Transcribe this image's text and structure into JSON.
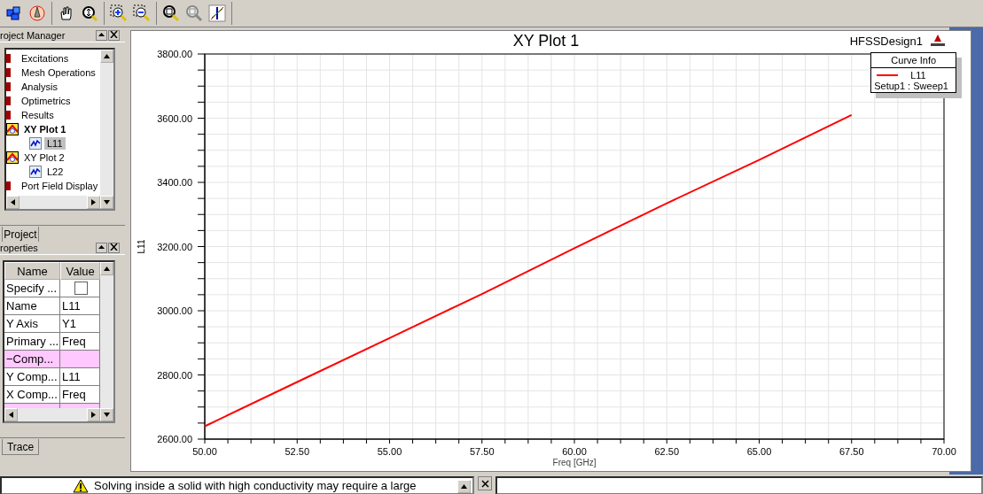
{
  "project_manager": {
    "title": "roject Manager",
    "tab": "Project",
    "tree": [
      {
        "label": "Excitations",
        "kind": "folder",
        "selected": false,
        "active": false
      },
      {
        "label": "Mesh Operations",
        "kind": "folder",
        "selected": false,
        "active": false
      },
      {
        "label": "Analysis",
        "kind": "folder",
        "selected": false,
        "active": false
      },
      {
        "label": "Optimetrics",
        "kind": "folder",
        "selected": false,
        "active": false
      },
      {
        "label": "Results",
        "kind": "folder",
        "selected": false,
        "active": false
      },
      {
        "label": "XY Plot 1",
        "kind": "plot",
        "selected": false,
        "active": true,
        "children": [
          {
            "label": "L11",
            "kind": "trace",
            "selected": true,
            "active": false
          }
        ]
      },
      {
        "label": "XY Plot 2",
        "kind": "plot",
        "selected": false,
        "active": false,
        "children": [
          {
            "label": "L22",
            "kind": "trace",
            "selected": false,
            "active": false
          }
        ]
      },
      {
        "label": "Port Field Display",
        "kind": "folder",
        "selected": false,
        "active": false
      }
    ]
  },
  "properties": {
    "title": "roperties",
    "tab": "Trace",
    "columns": [
      "Name",
      "Value"
    ],
    "rows": [
      {
        "kind": "checkbox",
        "name": "Specify ...",
        "checked": false
      },
      {
        "kind": "text",
        "name": "Name",
        "value": "L11"
      },
      {
        "kind": "text",
        "name": "Y Axis",
        "value": "Y1"
      },
      {
        "kind": "text",
        "name": "Primary ...",
        "value": "Freq"
      },
      {
        "kind": "section",
        "name": "−Comp..."
      },
      {
        "kind": "text",
        "name": "Y Comp...",
        "value": "L11"
      },
      {
        "kind": "text",
        "name": "X Comp...",
        "value": "Freq"
      },
      {
        "kind": "section"
      }
    ]
  },
  "plot": {
    "title": "XY Plot 1",
    "design": "HFSSDesign1",
    "legend": {
      "title": "Curve Info",
      "detail": "Setup1 : Sweep1"
    },
    "chart_data": {
      "type": "line",
      "xlabel": "Freq [GHz]",
      "ylabel": "L11",
      "grid": true,
      "x": [
        50,
        52.5,
        55,
        57.5,
        60,
        62.5,
        65,
        67.5
      ],
      "series": [
        {
          "name": "L11",
          "color": "#ff0000",
          "values": [
            2640,
            2778,
            2915,
            3052,
            3195,
            3335,
            3470,
            3610
          ]
        }
      ],
      "xlim": [
        50,
        70
      ],
      "ylim": [
        2600,
        3800
      ],
      "xticks": [
        {
          "value": 50,
          "label": "50.00"
        },
        {
          "value": 52.5,
          "label": "52.50"
        },
        {
          "value": 55,
          "label": "55.00"
        },
        {
          "value": 57.5,
          "label": "57.50"
        },
        {
          "value": 60,
          "label": "60.00"
        },
        {
          "value": 62.5,
          "label": "62.50"
        },
        {
          "value": 65,
          "label": "65.00"
        },
        {
          "value": 67.5,
          "label": "67.50"
        },
        {
          "value": 70,
          "label": "70.00"
        }
      ],
      "yticks": [
        {
          "value": 2600,
          "label": "2600.00"
        },
        {
          "value": 2800,
          "label": "2800.00"
        },
        {
          "value": 3000,
          "label": "3000.00"
        },
        {
          "value": 3200,
          "label": "3200.00"
        },
        {
          "value": 3400,
          "label": "3400.00"
        },
        {
          "value": 3600,
          "label": "3600.00"
        },
        {
          "value": 3800,
          "label": "3800.00"
        }
      ]
    }
  },
  "message": {
    "text": "Solving inside a solid with high conductivity may require a large"
  }
}
